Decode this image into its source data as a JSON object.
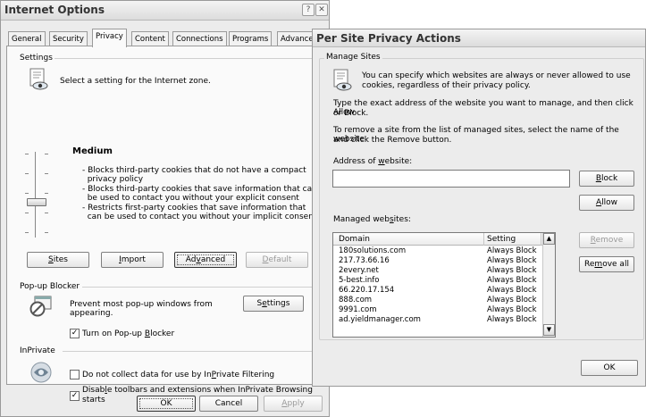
{
  "internet_options": {
    "title": "Internet Options",
    "title_buttons": {
      "help": "?",
      "close": "✕"
    },
    "tabs": [
      "General",
      "Security",
      "Privacy",
      "Content",
      "Connections",
      "Programs",
      "Advanced"
    ],
    "active_tab": "Privacy",
    "settings": {
      "group_label": "Settings",
      "intro": "Select a setting for the Internet zone.",
      "level": "Medium",
      "descriptions": [
        "- Blocks third-party cookies that do not have a compact",
        "  privacy policy",
        "- Blocks third-party cookies that save information that can",
        "  be used to contact you without your explicit consent",
        "- Restricts first-party cookies that save information that",
        "  can be used to contact you without your implicit consent"
      ],
      "buttons": {
        "sites": {
          "pre": "",
          "key": "S",
          "post": "ites"
        },
        "import": {
          "pre": "",
          "key": "I",
          "post": "mport"
        },
        "advanced": {
          "pre": "Ad",
          "key": "v",
          "post": "anced"
        },
        "default": {
          "pre": "",
          "key": "D",
          "post": "efault"
        }
      }
    },
    "popup": {
      "group_label": "Pop-up Blocker",
      "text_line1": "Prevent most pop-up windows from",
      "text_line2": "appearing.",
      "settings_button": {
        "pre": "S",
        "key": "e",
        "post": "ttings"
      },
      "checkbox": {
        "pre": "Turn on Pop-up ",
        "key": "B",
        "post": "locker",
        "checked": "✓"
      }
    },
    "inprivate": {
      "group_label": "InPrivate",
      "checkbox1": {
        "pre": "Do not collect data for use by In",
        "key": "P",
        "post": "rivate Filtering",
        "checked": ""
      },
      "checkbox2": {
        "pre": "Disab",
        "key": "l",
        "post": "e toolbars and extensions when InPrivate Browsing",
        "line2": "starts",
        "checked": "✓"
      }
    },
    "footer": {
      "ok": "OK",
      "cancel": "Cancel",
      "apply": {
        "pre": "",
        "key": "A",
        "post": "pply"
      }
    }
  },
  "per_site": {
    "title": "Per Site Privacy Actions",
    "group_label": "Manage Sites",
    "intro_line1": "You can specify which websites are always or never allowed to use",
    "intro_line2": "cookies, regardless of their privacy policy.",
    "instruction1_line1": "Type the exact address of the website you want to manage, and then click Allow",
    "instruction1_line2": "or Block.",
    "instruction2_line1": "To remove a site from the list of managed sites, select the name of the website",
    "instruction2_line2": "and click the Remove button.",
    "address_label": {
      "pre": "Address of ",
      "key": "w",
      "post": "ebsite:"
    },
    "address_value": "",
    "block": {
      "pre": "",
      "key": "B",
      "post": "lock"
    },
    "allow": {
      "pre": "",
      "key": "A",
      "post": "llow"
    },
    "managed_label": {
      "pre": "Managed web",
      "key": "s",
      "post": "ites:"
    },
    "columns": [
      "Domain",
      "Setting"
    ],
    "rows": [
      {
        "domain": "180solutions.com",
        "setting": "Always Block"
      },
      {
        "domain": "217.73.66.16",
        "setting": "Always Block"
      },
      {
        "domain": "2every.net",
        "setting": "Always Block"
      },
      {
        "domain": "5-best.info",
        "setting": "Always Block"
      },
      {
        "domain": "66.220.17.154",
        "setting": "Always Block"
      },
      {
        "domain": "888.com",
        "setting": "Always Block"
      },
      {
        "domain": "9991.com",
        "setting": "Always Block"
      },
      {
        "domain": "ad.yieldmanager.com",
        "setting": "Always Block"
      }
    ],
    "remove": {
      "pre": "",
      "key": "R",
      "post": "emove"
    },
    "remove_all": {
      "pre": "Re",
      "key": "m",
      "post": "ove all"
    },
    "ok": "OK",
    "scroll_up": "▲",
    "scroll_down": "▼"
  }
}
